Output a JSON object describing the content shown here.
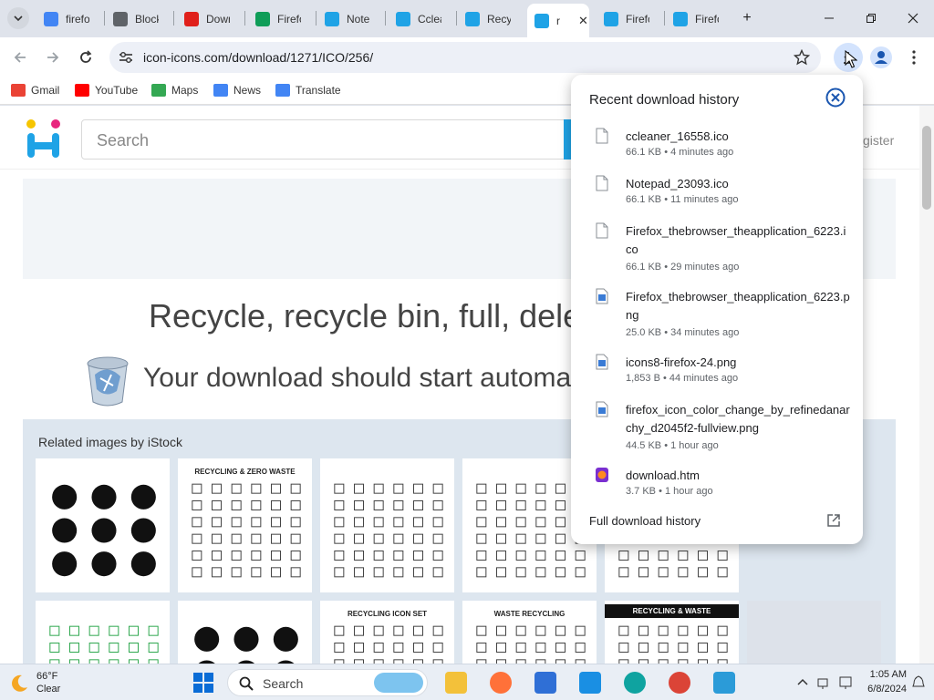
{
  "browser": {
    "tabs": [
      {
        "label": "firefo",
        "icon": "google-icon",
        "color": "#4285f4"
      },
      {
        "label": "Block",
        "icon": "globe-icon",
        "color": "#5f6368"
      },
      {
        "label": "Down",
        "icon": "opera-icon",
        "color": "#e0201b"
      },
      {
        "label": "Firefo",
        "icon": "sheets-icon",
        "color": "#0f9d58"
      },
      {
        "label": "Notep",
        "icon": "iconicons-icon",
        "color": "#1fa3e6"
      },
      {
        "label": "Cclea",
        "icon": "iconicons-icon",
        "color": "#1fa3e6"
      },
      {
        "label": "Recyc",
        "icon": "iconicons-icon",
        "color": "#1fa3e6"
      },
      {
        "label": "r",
        "icon": "iconicons-icon",
        "color": "#1fa3e6",
        "active": true
      },
      {
        "label": "Firefo",
        "icon": "iconicons-icon",
        "color": "#1fa3e6"
      },
      {
        "label": "Firefo",
        "icon": "iconicons-icon",
        "color": "#1fa3e6"
      }
    ],
    "url": "icon-icons.com/download/1271/ICO/256/",
    "bookmarks": [
      {
        "label": "Gmail",
        "color": "#ea4335"
      },
      {
        "label": "YouTube",
        "color": "#ff0000"
      },
      {
        "label": "Maps",
        "color": "#34a853"
      },
      {
        "label": "News",
        "color": "#4285f4"
      },
      {
        "label": "Translate",
        "color": "#4285f4"
      }
    ]
  },
  "site": {
    "search_placeholder": "Search",
    "register": "gister",
    "headline": "Recycle, recycle bin, full, dele",
    "subline": "Your download should start automa",
    "related_title": "Related images by iStock",
    "thumb_captions": [
      "",
      "RECYCLING & ZERO WASTE",
      "",
      "",
      "",
      "",
      "",
      "RECYCLING ICON SET",
      "WASTE RECYCLING",
      "RECYCLING & WASTE",
      ""
    ]
  },
  "downloads": {
    "title": "Recent download history",
    "items": [
      {
        "name": "ccleaner_16558.ico",
        "meta": "66.1 KB • 4 minutes ago",
        "type": "file"
      },
      {
        "name": "Notepad_23093.ico",
        "meta": "66.1 KB • 11 minutes ago",
        "type": "file"
      },
      {
        "name": "Firefox_thebrowser_theapplication_6223.ico",
        "meta": "66.1 KB • 29 minutes ago",
        "type": "file"
      },
      {
        "name": "Firefox_thebrowser_theapplication_6223.png",
        "meta": "25.0 KB • 34 minutes ago",
        "type": "image"
      },
      {
        "name": "icons8-firefox-24.png",
        "meta": "1,853 B • 44 minutes ago",
        "type": "image"
      },
      {
        "name": "firefox_icon_color_change_by_refinedanarchy_d2045f2-fullview.png",
        "meta": "44.5 KB • 1 hour ago",
        "type": "image"
      },
      {
        "name": "download.htm",
        "meta": "3.7 KB • 1 hour ago",
        "type": "html"
      }
    ],
    "footer": "Full download history"
  },
  "taskbar": {
    "temp": "66°F",
    "condition": "Clear",
    "search": "Search",
    "time": "1:05 AM",
    "date": "6/8/2024"
  }
}
